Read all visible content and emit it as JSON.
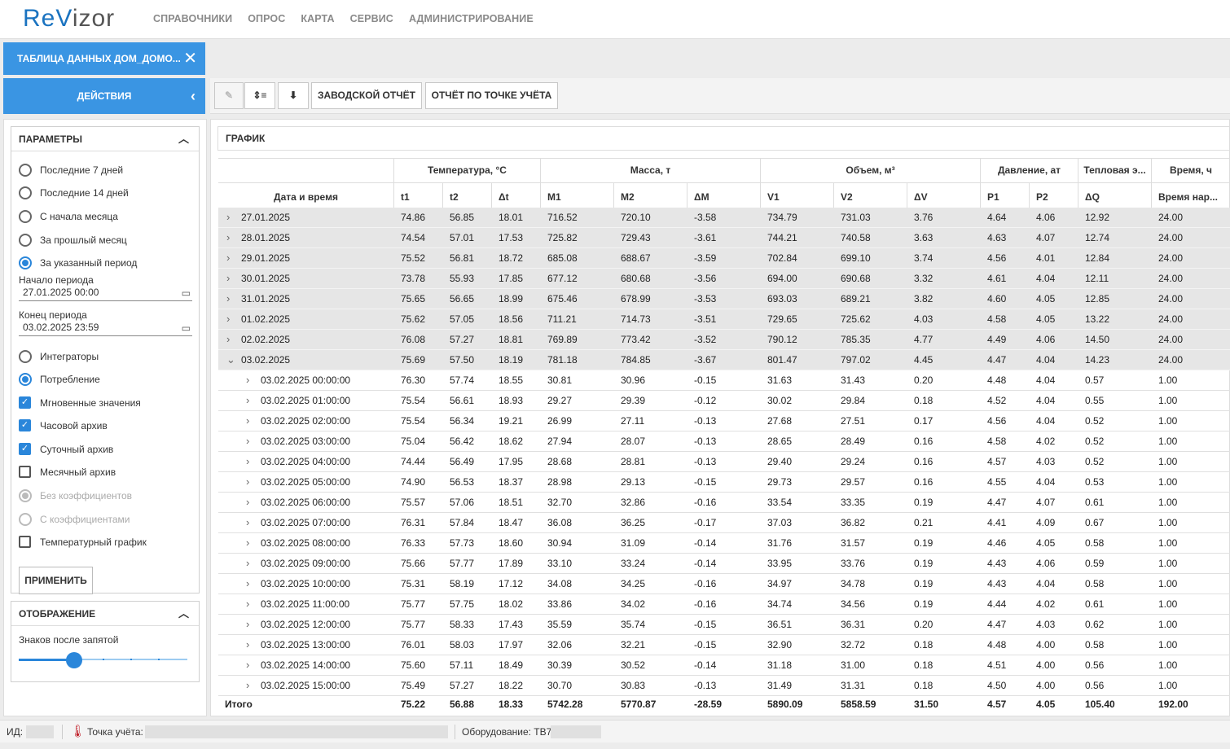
{
  "app": {
    "logo_first": "ReV",
    "logo_rest": "izor"
  },
  "nav": [
    "СПРАВОЧНИКИ",
    "ОПРОС",
    "КАРТА",
    "СЕРВИС",
    "АДМИНИСТРИРОВАНИЕ"
  ],
  "tab": {
    "label": "ТАБЛИЦА ДАННЫХ ДОМ_ДОМО...",
    "close": "✕"
  },
  "actions": {
    "label": "ДЕЙСТВИЯ",
    "chevron": "‹"
  },
  "toolbar": {
    "edit_icon": "✎",
    "rows_icon": "⇕≡",
    "download_icon": "⬇",
    "factory_report": "ЗАВОДСКОЙ ОТЧЁТ",
    "point_report": "ОТЧЁТ ПО ТОЧКЕ УЧЁТА"
  },
  "params": {
    "title": "ПАРАМЕТРЫ",
    "period_options": [
      "Последние 7 дней",
      "Последние 14 дней",
      "С начала месяца",
      "За прошлый месяц",
      "За указанный период"
    ],
    "start_label": "Начало периода",
    "start_value": "27.01.2025 00:00",
    "end_label": "Конец периода",
    "end_value": "03.02.2025 23:59",
    "mode_options": [
      "Интеграторы",
      "Потребление"
    ],
    "checks": [
      "Мгновенные значения",
      "Часовой архив",
      "Суточный архив",
      "Месячный архив"
    ],
    "coef_options": [
      "Без коэффициентов",
      "С коэффициентами"
    ],
    "temp_graph": "Температурный график",
    "apply": "ПРИМЕНИТЬ"
  },
  "display": {
    "title": "ОТОБРАЖЕНИЕ",
    "decimals_label": "Знаков после запятой",
    "decimals_level": 0.33
  },
  "grid": {
    "title": "ГРАФИК",
    "group_headers": [
      "Температура, °C",
      "Масса, т",
      "Объем, м³",
      "Давление, ат",
      "Тепловая э...",
      "Время, ч"
    ],
    "date_header": "Дата и время",
    "sub_headers": [
      "t1",
      "t2",
      "Δt",
      "M1",
      "M2",
      "ΔM",
      "V1",
      "V2",
      "ΔV",
      "P1",
      "P2",
      "ΔQ",
      "Время нар..."
    ],
    "day_rows": [
      [
        "27.01.2025",
        "74.86",
        "56.85",
        "18.01",
        "716.52",
        "720.10",
        "-3.58",
        "734.79",
        "731.03",
        "3.76",
        "4.64",
        "4.06",
        "12.92",
        "24.00"
      ],
      [
        "28.01.2025",
        "74.54",
        "57.01",
        "17.53",
        "725.82",
        "729.43",
        "-3.61",
        "744.21",
        "740.58",
        "3.63",
        "4.63",
        "4.07",
        "12.74",
        "24.00"
      ],
      [
        "29.01.2025",
        "75.52",
        "56.81",
        "18.72",
        "685.08",
        "688.67",
        "-3.59",
        "702.84",
        "699.10",
        "3.74",
        "4.56",
        "4.01",
        "12.84",
        "24.00"
      ],
      [
        "30.01.2025",
        "73.78",
        "55.93",
        "17.85",
        "677.12",
        "680.68",
        "-3.56",
        "694.00",
        "690.68",
        "3.32",
        "4.61",
        "4.04",
        "12.11",
        "24.00"
      ],
      [
        "31.01.2025",
        "75.65",
        "56.65",
        "18.99",
        "675.46",
        "678.99",
        "-3.53",
        "693.03",
        "689.21",
        "3.82",
        "4.60",
        "4.05",
        "12.85",
        "24.00"
      ],
      [
        "01.02.2025",
        "75.62",
        "57.05",
        "18.56",
        "711.21",
        "714.73",
        "-3.51",
        "729.65",
        "725.62",
        "4.03",
        "4.58",
        "4.05",
        "13.22",
        "24.00"
      ],
      [
        "02.02.2025",
        "76.08",
        "57.27",
        "18.81",
        "769.89",
        "773.42",
        "-3.52",
        "790.12",
        "785.35",
        "4.77",
        "4.49",
        "4.06",
        "14.50",
        "24.00"
      ],
      [
        "03.02.2025",
        "75.69",
        "57.50",
        "18.19",
        "781.18",
        "784.85",
        "-3.67",
        "801.47",
        "797.02",
        "4.45",
        "4.47",
        "4.04",
        "14.23",
        "24.00"
      ]
    ],
    "hour_rows": [
      [
        "03.02.2025 00:00:00",
        "76.30",
        "57.74",
        "18.55",
        "30.81",
        "30.96",
        "-0.15",
        "31.63",
        "31.43",
        "0.20",
        "4.48",
        "4.04",
        "0.57",
        "1.00"
      ],
      [
        "03.02.2025 01:00:00",
        "75.54",
        "56.61",
        "18.93",
        "29.27",
        "29.39",
        "-0.12",
        "30.02",
        "29.84",
        "0.18",
        "4.52",
        "4.04",
        "0.55",
        "1.00"
      ],
      [
        "03.02.2025 02:00:00",
        "75.54",
        "56.34",
        "19.21",
        "26.99",
        "27.11",
        "-0.13",
        "27.68",
        "27.51",
        "0.17",
        "4.56",
        "4.04",
        "0.52",
        "1.00"
      ],
      [
        "03.02.2025 03:00:00",
        "75.04",
        "56.42",
        "18.62",
        "27.94",
        "28.07",
        "-0.13",
        "28.65",
        "28.49",
        "0.16",
        "4.58",
        "4.02",
        "0.52",
        "1.00"
      ],
      [
        "03.02.2025 04:00:00",
        "74.44",
        "56.49",
        "17.95",
        "28.68",
        "28.81",
        "-0.13",
        "29.40",
        "29.24",
        "0.16",
        "4.57",
        "4.03",
        "0.52",
        "1.00"
      ],
      [
        "03.02.2025 05:00:00",
        "74.90",
        "56.53",
        "18.37",
        "28.98",
        "29.13",
        "-0.15",
        "29.73",
        "29.57",
        "0.16",
        "4.55",
        "4.04",
        "0.53",
        "1.00"
      ],
      [
        "03.02.2025 06:00:00",
        "75.57",
        "57.06",
        "18.51",
        "32.70",
        "32.86",
        "-0.16",
        "33.54",
        "33.35",
        "0.19",
        "4.47",
        "4.07",
        "0.61",
        "1.00"
      ],
      [
        "03.02.2025 07:00:00",
        "76.31",
        "57.84",
        "18.47",
        "36.08",
        "36.25",
        "-0.17",
        "37.03",
        "36.82",
        "0.21",
        "4.41",
        "4.09",
        "0.67",
        "1.00"
      ],
      [
        "03.02.2025 08:00:00",
        "76.33",
        "57.73",
        "18.60",
        "30.94",
        "31.09",
        "-0.14",
        "31.76",
        "31.57",
        "0.19",
        "4.46",
        "4.05",
        "0.58",
        "1.00"
      ],
      [
        "03.02.2025 09:00:00",
        "75.66",
        "57.77",
        "17.89",
        "33.10",
        "33.24",
        "-0.14",
        "33.95",
        "33.76",
        "0.19",
        "4.43",
        "4.06",
        "0.59",
        "1.00"
      ],
      [
        "03.02.2025 10:00:00",
        "75.31",
        "58.19",
        "17.12",
        "34.08",
        "34.25",
        "-0.16",
        "34.97",
        "34.78",
        "0.19",
        "4.43",
        "4.04",
        "0.58",
        "1.00"
      ],
      [
        "03.02.2025 11:00:00",
        "75.77",
        "57.75",
        "18.02",
        "33.86",
        "34.02",
        "-0.16",
        "34.74",
        "34.56",
        "0.19",
        "4.44",
        "4.02",
        "0.61",
        "1.00"
      ],
      [
        "03.02.2025 12:00:00",
        "75.77",
        "58.33",
        "17.43",
        "35.59",
        "35.74",
        "-0.15",
        "36.51",
        "36.31",
        "0.20",
        "4.47",
        "4.03",
        "0.62",
        "1.00"
      ],
      [
        "03.02.2025 13:00:00",
        "76.01",
        "58.03",
        "17.97",
        "32.06",
        "32.21",
        "-0.15",
        "32.90",
        "32.72",
        "0.18",
        "4.48",
        "4.00",
        "0.58",
        "1.00"
      ],
      [
        "03.02.2025 14:00:00",
        "75.60",
        "57.11",
        "18.49",
        "30.39",
        "30.52",
        "-0.14",
        "31.18",
        "31.00",
        "0.18",
        "4.51",
        "4.00",
        "0.56",
        "1.00"
      ],
      [
        "03.02.2025 15:00:00",
        "75.49",
        "57.27",
        "18.22",
        "30.70",
        "30.83",
        "-0.13",
        "31.49",
        "31.31",
        "0.18",
        "4.50",
        "4.00",
        "0.56",
        "1.00"
      ]
    ],
    "total_row": [
      "Итого",
      "75.22",
      "56.88",
      "18.33",
      "5742.28",
      "5770.87",
      "-28.59",
      "5890.09",
      "5858.59",
      "31.50",
      "4.57",
      "4.05",
      "105.40",
      "192.00"
    ]
  },
  "status": {
    "id_label": "ИД:",
    "point_label": "Точка учёта:",
    "equipment_label": "Оборудование: ТВ7"
  }
}
